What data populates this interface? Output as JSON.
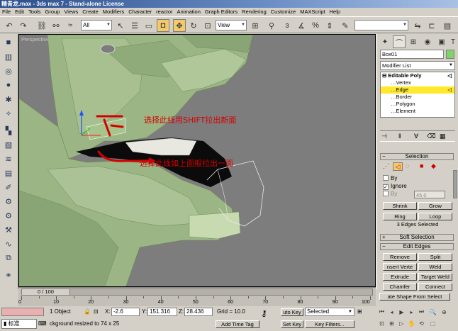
{
  "window": {
    "title": "精青龙.max - 3ds max 7 - Stand-alone License"
  },
  "menu": [
    "File",
    "Edit",
    "Tools",
    "Group",
    "Views",
    "Create",
    "Modifiers",
    "Character",
    "reactor",
    "Animation",
    "Graph Editors",
    "Rendering",
    "Customize",
    "MAXScript",
    "Help"
  ],
  "toolbar": {
    "selection_filter": "All",
    "ref_coord": "View",
    "named_selection": ""
  },
  "viewport": {
    "label": "Perspective",
    "annotation_top": "选择此线用SHIFT拉出新面",
    "annotation_bottom": "选择此线如上面般拉出一面",
    "colors": {
      "model": "#9bb585",
      "background": "#7d7d7d",
      "annotation": "#d40000"
    }
  },
  "command_panel": {
    "object_name": "Box01",
    "object_color": "#7fd36a",
    "modifier_list": "Modifier List",
    "stack": {
      "top": "Editable Poly",
      "items": [
        "Vertex",
        "Edge",
        "Border",
        "Polygon",
        "Element"
      ],
      "selected": "Edge"
    },
    "selection": {
      "header": "Selection",
      "by_vertex": "By",
      "ignore_backfacing": "Ignore",
      "by_angle": "By",
      "angle_value": "45.0",
      "shrink": "Shrink",
      "grow": "Grow",
      "ring": "Ring",
      "loop": "Loop",
      "status": "3 Edges Selected"
    },
    "soft_selection": "Soft Selection",
    "edit_edges": {
      "header": "Edit Edges",
      "buttons": [
        "Remove",
        "Split",
        "nsert Verte",
        "Weld",
        "Extrude",
        "Target Weld",
        "Chamfer",
        "Connect",
        "ate Shape From Select"
      ]
    }
  },
  "timeline": {
    "frame": "0 / 100",
    "ticks": [
      "0",
      "10",
      "20",
      "30",
      "40",
      "50",
      "60",
      "70",
      "80",
      "90",
      "100"
    ]
  },
  "status": {
    "objects": "1 Object",
    "x_label": "X:",
    "x_value": "-2.6",
    "y_label": "Y:",
    "y_value": "151.316",
    "z_label": "Z:",
    "z_value": "28.436",
    "grid": "Grid = 10.0",
    "auto_key": "uto Key",
    "set_key": "Set Key",
    "key_mode": "Selected",
    "key_filters": "Key Filters...",
    "prompt": "ckground resized to 74 x 25",
    "add_time_tag": "Add Time Tag",
    "ime": "标准"
  }
}
